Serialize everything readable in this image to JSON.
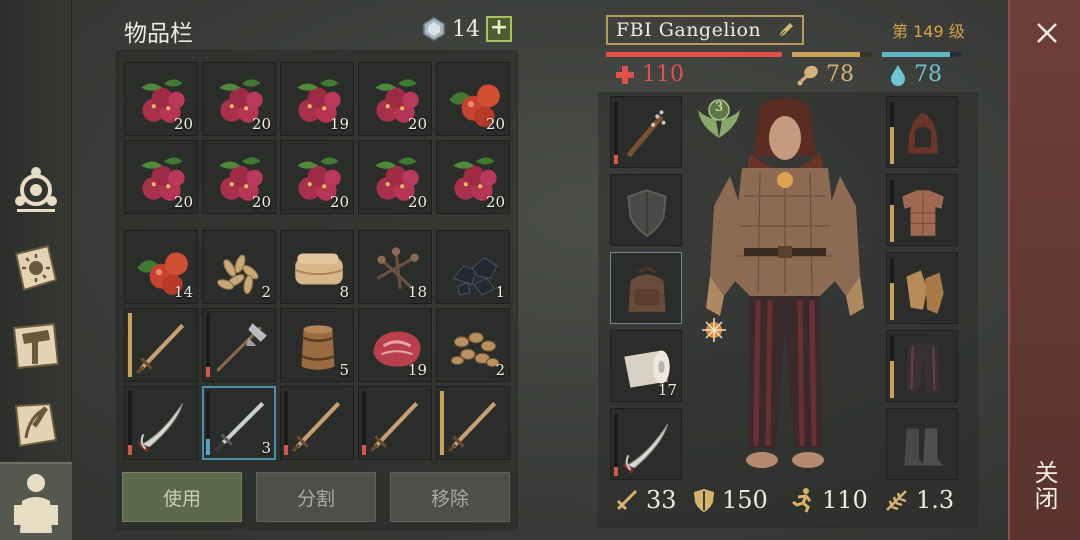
{
  "inventory": {
    "title": "物品栏",
    "gem_count": "14",
    "add_label": "+",
    "slots": [
      {
        "item": "berries",
        "count": "20"
      },
      {
        "item": "berries",
        "count": "20"
      },
      {
        "item": "berries",
        "count": "19"
      },
      {
        "item": "berries",
        "count": "20"
      },
      {
        "item": "apples",
        "count": "20"
      },
      {
        "item": "berries",
        "count": "20"
      },
      {
        "item": "berries",
        "count": "20"
      },
      {
        "item": "berries",
        "count": "20"
      },
      {
        "item": "berries",
        "count": "20"
      },
      {
        "item": "berries",
        "count": "20"
      },
      {
        "item": "apples",
        "count": "14"
      },
      {
        "item": "seeds",
        "count": "2"
      },
      {
        "item": "leather",
        "count": "8"
      },
      {
        "item": "nails",
        "count": "18"
      },
      {
        "item": "coal",
        "count": "1"
      },
      {
        "item": "wooden-sword",
        "durability": 1.0
      },
      {
        "item": "halberd",
        "durability": 0.15
      },
      {
        "item": "barrel",
        "count": "5"
      },
      {
        "item": "raw-meat",
        "count": "19"
      },
      {
        "item": "nuts",
        "count": "2"
      },
      {
        "item": "scimitar",
        "durability": 0.15
      },
      {
        "item": "steel-sword",
        "count": "3",
        "durability": 0.25,
        "selected": true
      },
      {
        "item": "wooden-sword",
        "durability": 0.15
      },
      {
        "item": "wooden-sword",
        "durability": 0.15
      },
      {
        "item": "wooden-sword",
        "durability": 1.0
      }
    ],
    "actions": {
      "use": "使用",
      "split": "分割",
      "remove": "移除"
    }
  },
  "character": {
    "name": "FBI Gangelion",
    "level": "第 149 级",
    "health": "110",
    "food": "78",
    "water": "78",
    "health_fraction": 1.0,
    "food_fraction": 0.85,
    "water_fraction": 0.85,
    "badge_level": "3",
    "left_slots": [
      {
        "item": "spiked-club",
        "durability": 0.15
      },
      {
        "item": "shield-empty"
      },
      {
        "item": "backpack",
        "selected": true
      },
      {
        "item": "cloth-roll",
        "count": "17"
      },
      {
        "item": "scimitar",
        "durability": 0.15
      }
    ],
    "right_slots": [
      {
        "item": "hood",
        "durability": 0.6
      },
      {
        "item": "gambeson",
        "durability": 0.6
      },
      {
        "item": "gloves",
        "durability": 0.6
      },
      {
        "item": "pants",
        "durability": 0.6
      },
      {
        "item": "boots-empty"
      }
    ],
    "stats": {
      "attack": "33",
      "defense": "150",
      "speed": "110",
      "weight": "1.3"
    }
  },
  "close": {
    "label": "关闭"
  },
  "colors": {
    "health": "#e2504a",
    "food": "#c9a25a",
    "water": "#5fb7c5",
    "accent_gold": "#d8a24a",
    "durability_red": "#d4574a",
    "durability_tan": "#c9a25a",
    "durability_blue": "#5a9fc4"
  }
}
